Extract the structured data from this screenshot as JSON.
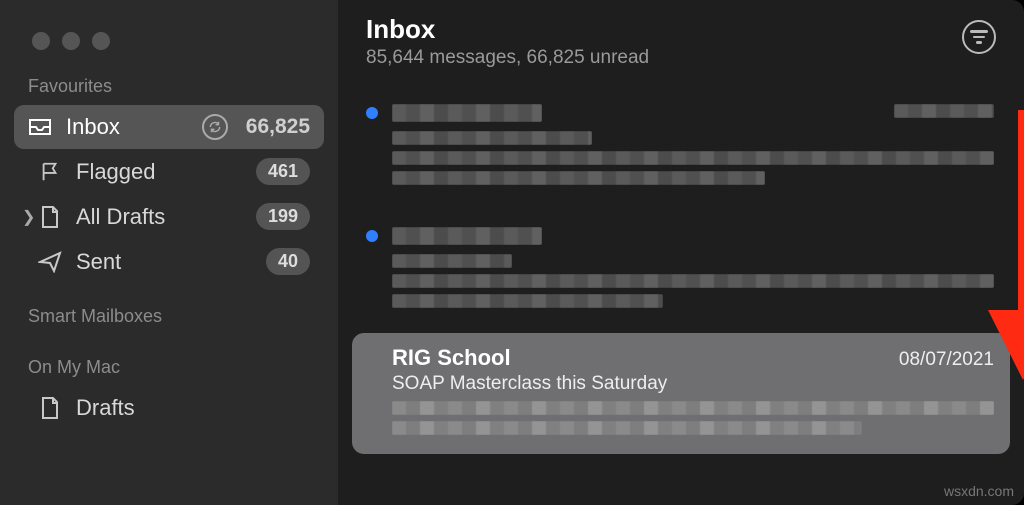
{
  "sidebar": {
    "sections": {
      "favourites": "Favourites",
      "smart": "Smart Mailboxes",
      "onmymac": "On My Mac"
    },
    "items": {
      "inbox": {
        "label": "Inbox",
        "count": "66,825"
      },
      "flagged": {
        "label": "Flagged",
        "badge": "461"
      },
      "drafts": {
        "label": "All Drafts",
        "badge": "199"
      },
      "sent": {
        "label": "Sent",
        "badge": "40"
      },
      "localdrafts": {
        "label": "Drafts"
      }
    }
  },
  "header": {
    "title": "Inbox",
    "subtitle": "85,644 messages, 66,825 unread"
  },
  "messages": {
    "selected": {
      "sender": "RIG School",
      "date": "08/07/2021",
      "subject": "SOAP Masterclass this Saturday"
    }
  },
  "watermark": "wsxdn.com"
}
